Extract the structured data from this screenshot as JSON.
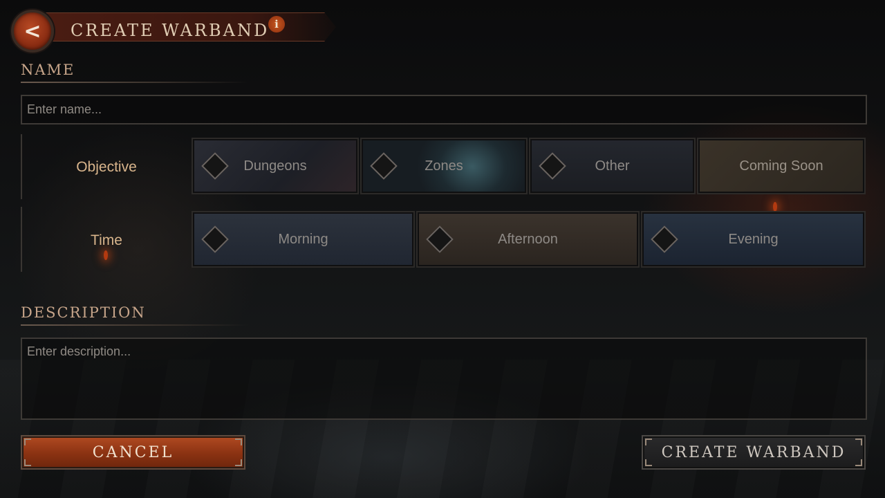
{
  "header": {
    "back_icon": "chevron-left-icon",
    "back_glyph": "<",
    "title": "CREATE WARBAND",
    "info_icon": "info-icon",
    "info_glyph": "i"
  },
  "name_section": {
    "label": "NAME",
    "placeholder": "Enter name...",
    "value": ""
  },
  "objective_row": {
    "label": "Objective",
    "options": [
      {
        "label": "Dungeons"
      },
      {
        "label": "Zones"
      },
      {
        "label": "Other"
      },
      {
        "label": "Coming Soon"
      }
    ]
  },
  "time_row": {
    "label": "Time",
    "options": [
      {
        "label": "Morning"
      },
      {
        "label": "Afternoon"
      },
      {
        "label": "Evening"
      }
    ]
  },
  "description_section": {
    "label": "DESCRIPTION",
    "placeholder": "Enter description...",
    "value": ""
  },
  "footer": {
    "cancel_label": "CANCEL",
    "create_label": "CREATE WARBAND"
  },
  "colors": {
    "accent_red": "#8a3212",
    "label_gold": "#d9b58c",
    "heading_tan": "#c7a58a"
  }
}
